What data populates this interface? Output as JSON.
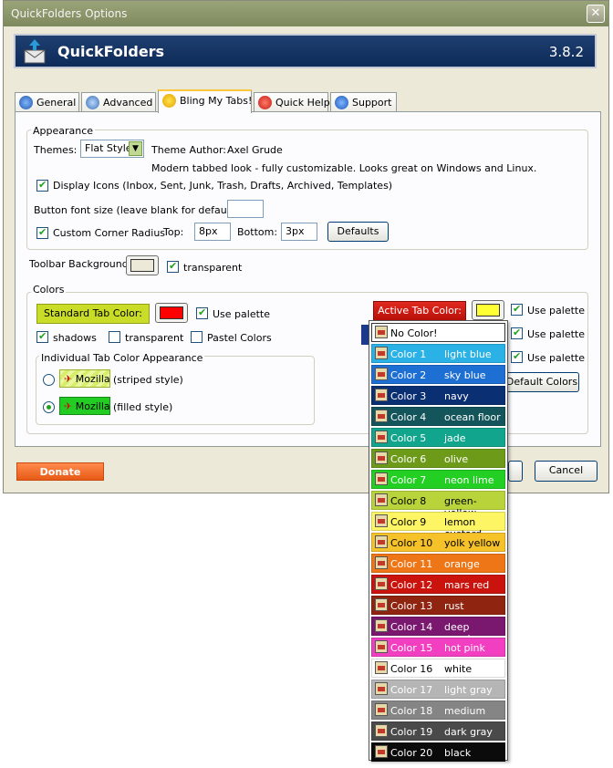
{
  "window": {
    "title": "QuickFolders Options",
    "close": "✕"
  },
  "header": {
    "app_name": "QuickFolders",
    "version": "3.8.2"
  },
  "tabs": [
    {
      "label": "General",
      "icon": "gear-icon"
    },
    {
      "label": "Advanced",
      "icon": "tools-icon"
    },
    {
      "label": "Bling My Tabs!",
      "icon": "smiley-icon"
    },
    {
      "label": "Quick Help",
      "icon": "help-icon"
    },
    {
      "label": "Support",
      "icon": "info-icon"
    }
  ],
  "appearance": {
    "legend": "Appearance",
    "themes_label": "Themes:",
    "theme_value": "Flat Style",
    "author_label": "Theme Author:",
    "author_value": "Axel Grude",
    "theme_desc": "Modern tabbed look - fully customizable. Looks great on Windows and Linux.",
    "display_icons": "Display Icons (Inbox, Sent, Junk, Trash, Drafts, Archived, Templates)",
    "font_size_label": "Button font size (leave blank for default):",
    "font_size_value": "",
    "corner_label": "Custom Corner Radius",
    "top_label": "Top:",
    "top_value": "8px",
    "bottom_label": "Bottom:",
    "bottom_value": "3px",
    "defaults_button": "Defaults"
  },
  "toolbar": {
    "label": "Toolbar Background:",
    "transparent_label": "transparent"
  },
  "colors": {
    "legend": "Colors",
    "standard_tab": "Standard Tab Color:",
    "use_palette": "Use palette",
    "shadows": "shadows",
    "transparent": "transparent",
    "pastel": "Pastel Colors",
    "active_tab": "Active Tab Color:",
    "use_palette_2": "Use palette",
    "use_palette_3": "Use palette",
    "default_colors_button": "Default Colors",
    "individual_legend": "Individual Tab Color Appearance",
    "mozilla": "Mozilla",
    "striped": "(striped style)",
    "filled": "(filled style)",
    "standard_color": "#ff0000",
    "active_color": "#ffff33"
  },
  "footer": {
    "donate": "Donate",
    "cancel": "Cancel"
  },
  "popup": {
    "no_color": "No Color!",
    "items": [
      {
        "num": "Color 1",
        "name": "light blue",
        "color": "#2ab2e6",
        "text": "#ffffff"
      },
      {
        "num": "Color 2",
        "name": "sky blue",
        "color": "#1e6fd3",
        "text": "#ffffff"
      },
      {
        "num": "Color 3",
        "name": "navy",
        "color": "#0b2f73",
        "text": "#ffffff"
      },
      {
        "num": "Color 4",
        "name": "ocean floor",
        "color": "#14555c",
        "text": "#ffffff"
      },
      {
        "num": "Color 5",
        "name": "jade",
        "color": "#11a58e",
        "text": "#ffffff"
      },
      {
        "num": "Color 6",
        "name": "olive",
        "color": "#6e9a1a",
        "text": "#ffffff"
      },
      {
        "num": "Color 7",
        "name": "neon lime",
        "color": "#22cf22",
        "text": "#ffffff"
      },
      {
        "num": "Color 8",
        "name": "green-yellow",
        "color": "#b9d33a",
        "text": "#000000"
      },
      {
        "num": "Color 9",
        "name": "lemon custard",
        "color": "#fdf563",
        "text": "#000000"
      },
      {
        "num": "Color 10",
        "name": "yolk yellow",
        "color": "#f6c22a",
        "text": "#000000"
      },
      {
        "num": "Color 11",
        "name": "orange",
        "color": "#ef7617",
        "text": "#ffffff"
      },
      {
        "num": "Color 12",
        "name": "mars red",
        "color": "#c9130c",
        "text": "#ffffff"
      },
      {
        "num": "Color 13",
        "name": "rust",
        "color": "#8f2410",
        "text": "#ffffff"
      },
      {
        "num": "Color 14",
        "name": "deep purple",
        "color": "#7a176e",
        "text": "#ffffff"
      },
      {
        "num": "Color 15",
        "name": "hot pink",
        "color": "#f23fc2",
        "text": "#ffffff"
      },
      {
        "num": "Color 16",
        "name": "white",
        "color": "#ffffff",
        "text": "#000000"
      },
      {
        "num": "Color 17",
        "name": "light gray",
        "color": "#b5b5b5",
        "text": "#ffffff"
      },
      {
        "num": "Color 18",
        "name": "medium gray",
        "color": "#858585",
        "text": "#ffffff"
      },
      {
        "num": "Color 19",
        "name": "dark gray",
        "color": "#4a4a4a",
        "text": "#ffffff"
      },
      {
        "num": "Color 20",
        "name": "black",
        "color": "#0b0b0b",
        "text": "#ffffff"
      }
    ]
  }
}
